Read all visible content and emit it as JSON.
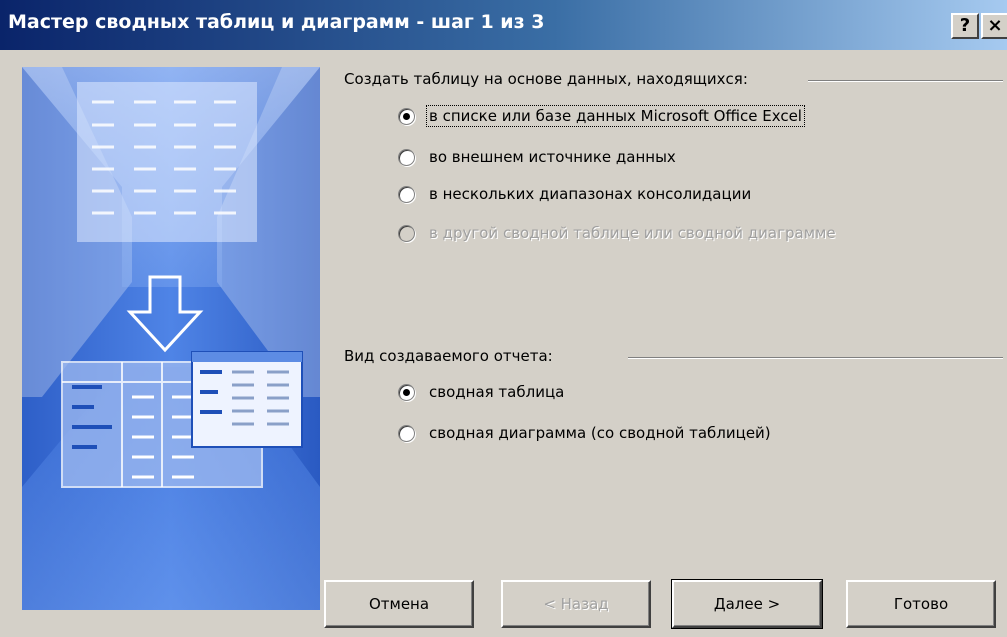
{
  "window": {
    "title": "Мастер сводных таблиц и диаграмм - шаг 1 из 3",
    "help_label": "?",
    "close_label": "×"
  },
  "source_group": {
    "label": "Создать таблицу на основе данных, находящихся:",
    "options": [
      {
        "label": "в списке или базе данных Microsoft Office Excel",
        "checked": true,
        "enabled": true
      },
      {
        "label": "во внешнем источнике данных",
        "checked": false,
        "enabled": true
      },
      {
        "label": "в нескольких диапазонах консолидации",
        "checked": false,
        "enabled": true
      },
      {
        "label": "в другой сводной таблице или сводной диаграмме",
        "checked": false,
        "enabled": false
      }
    ]
  },
  "report_group": {
    "label": "Вид создаваемого отчета:",
    "options": [
      {
        "label": "сводная таблица",
        "checked": true,
        "enabled": true
      },
      {
        "label": "сводная диаграмма (со сводной таблицей)",
        "checked": false,
        "enabled": true
      }
    ]
  },
  "buttons": {
    "cancel": "Отмена",
    "back": "< Назад",
    "next": "Далее >",
    "finish": "Готово"
  },
  "colors": {
    "title_start": "#0a246a",
    "title_end": "#a6caf0",
    "dialog_face": "#d4d0c8",
    "art_blue": "#3b6fd6"
  }
}
